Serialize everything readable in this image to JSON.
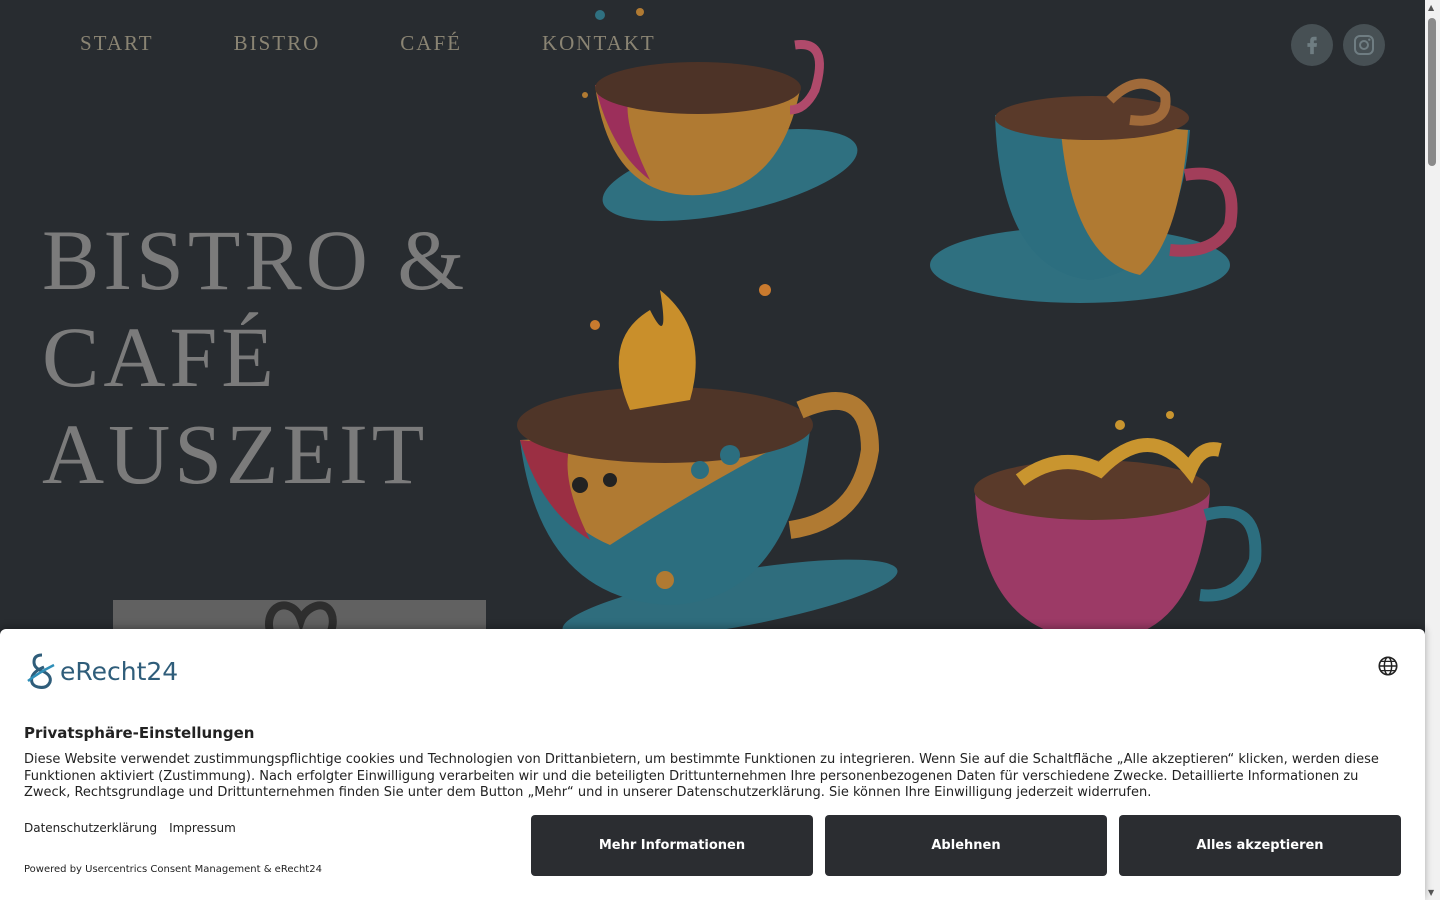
{
  "nav": {
    "items": [
      {
        "label": "START"
      },
      {
        "label": "BISTRO"
      },
      {
        "label": "CAFÉ"
      },
      {
        "label": "KONTAKT"
      }
    ]
  },
  "social": {
    "items": [
      {
        "icon": "facebook-icon"
      },
      {
        "icon": "instagram-icon"
      }
    ]
  },
  "hero": {
    "title_lines": [
      "BISTRO &",
      "CAFÉ",
      "AUSZEIT"
    ]
  },
  "consent": {
    "brand": "eRecht24",
    "title": "Privatsphäre-Einstellungen",
    "text": "Diese Website verwendet zustimmungspflichtige cookies und Technologien von Drittanbietern, um bestimmte Funktionen zu integrieren. Wenn Sie auf die Schaltfläche „Alle akzeptieren“ klicken, werden diese Funktionen aktiviert (Zustimmung). Nach erfolgter Einwilligung verarbeiten wir und die beteiligten Drittunternehmen Ihre personenbezogenen Daten für verschiedene Zwecke. Detaillierte Informationen zu Zweck, Rechtsgrundlage und Drittunternehmen finden Sie unter dem Button „Mehr“ und in unserer Datenschutzerklärung. Sie können Ihre Einwilligung jederzeit widerrufen.",
    "links": [
      {
        "label": "Datenschutzerklärung"
      },
      {
        "label": "Impressum"
      }
    ],
    "powered": "Powered by Usercentrics Consent Management & eRecht24",
    "buttons": {
      "more": "Mehr Informationen",
      "deny": "Ablehnen",
      "accept": "Alles akzeptieren"
    }
  },
  "colors": {
    "background": "#282c30",
    "nav_text": "#8a8473",
    "title_text": "#7b7b7b",
    "button_bg": "#2b2d31",
    "brand": "#2f5d7a"
  }
}
